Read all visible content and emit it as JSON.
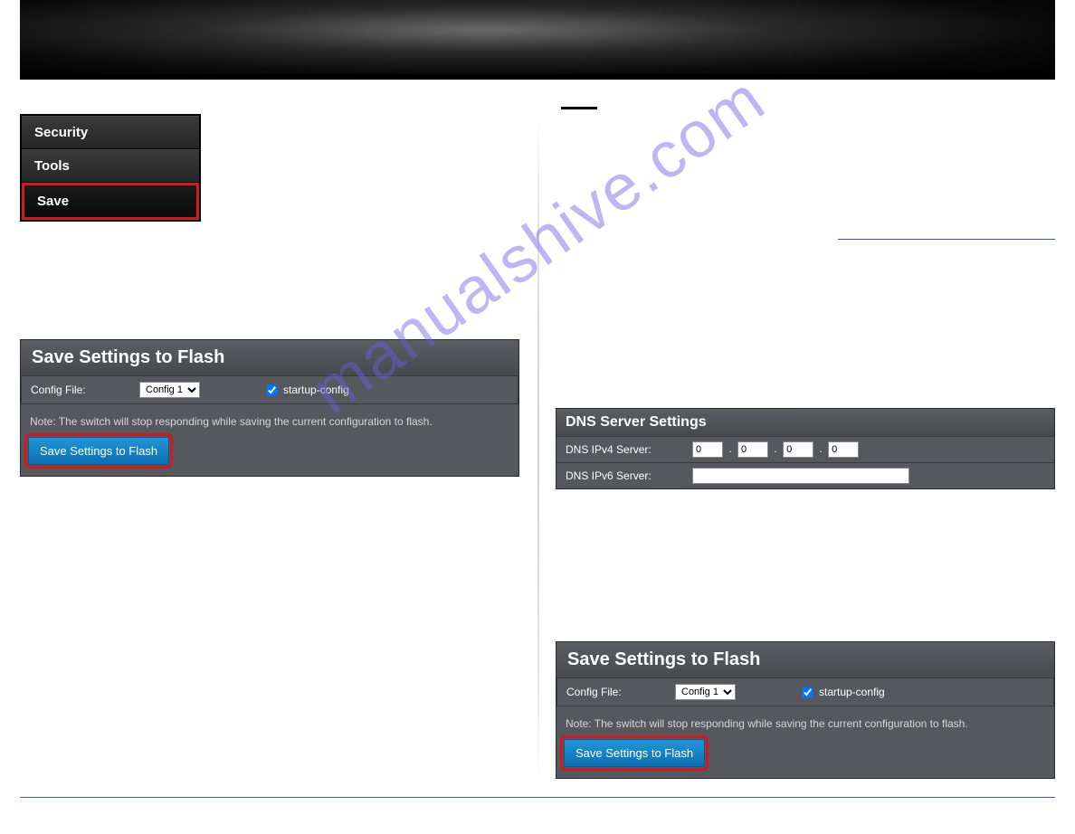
{
  "watermark": "manualshive.com",
  "sidebar": {
    "items": [
      {
        "label": "Security"
      },
      {
        "label": "Tools"
      },
      {
        "label": "Save"
      }
    ]
  },
  "save_panel": {
    "title": "Save Settings to Flash",
    "config_label": "Config File:",
    "config_selected": "Config 1",
    "startup_label": "startup-config",
    "note": "Note: The switch will stop responding while saving the current configuration to flash.",
    "button_label": "Save Settings to Flash"
  },
  "dns_panel": {
    "title": "DNS Server Settings",
    "ipv4_label": "DNS IPv4 Server:",
    "ipv4": [
      "0",
      "0",
      "0",
      "0"
    ],
    "ipv6_label": "DNS IPv6 Server:",
    "ipv6_value": ""
  }
}
